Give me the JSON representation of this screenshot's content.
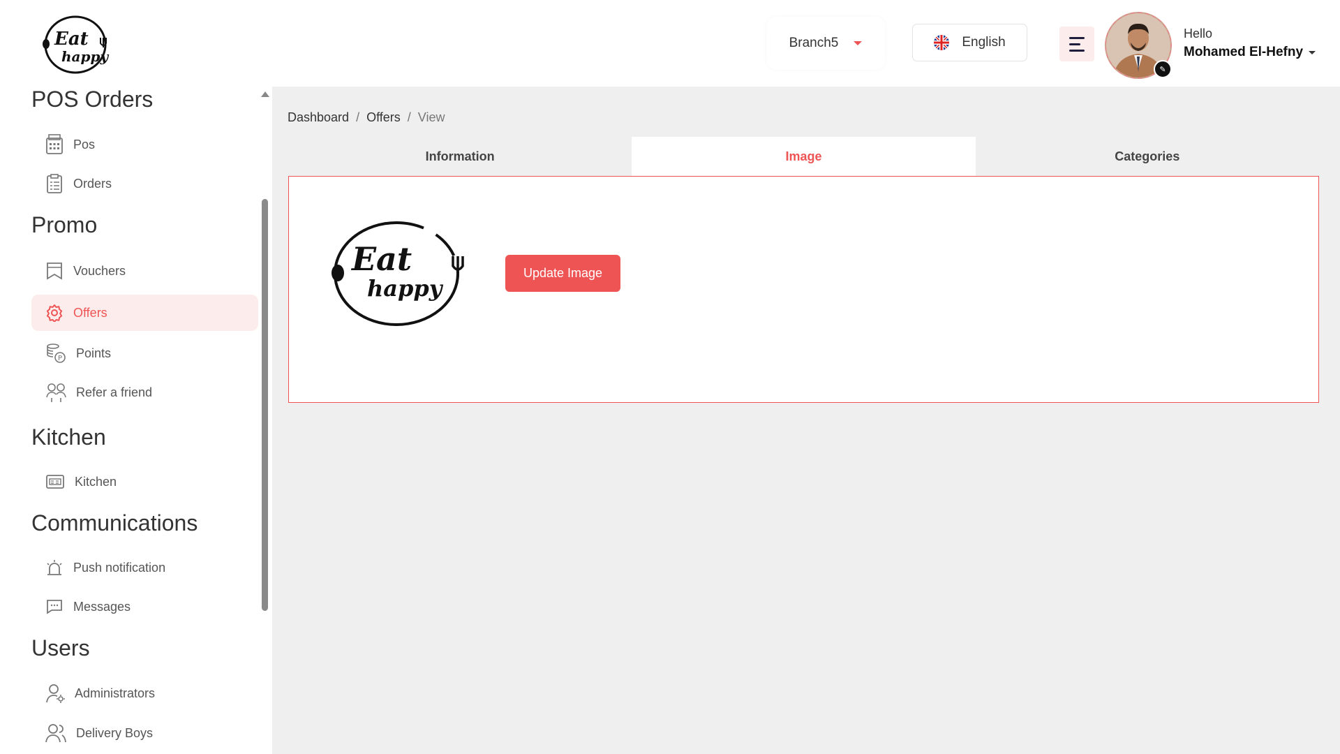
{
  "brand": {
    "logo_line1": "Eat",
    "logo_line2": "happy"
  },
  "header": {
    "branch": "Branch5",
    "language": "English",
    "greeting": "Hello",
    "user_name": "Mohamed El-Hefny"
  },
  "sidebar": {
    "sections": [
      {
        "title": "POS Orders",
        "items": [
          {
            "label": "Pos",
            "icon": "pos-icon"
          },
          {
            "label": "Orders",
            "icon": "orders-icon"
          }
        ]
      },
      {
        "title": "Promo",
        "items": [
          {
            "label": "Vouchers",
            "icon": "voucher-icon"
          },
          {
            "label": "Offers",
            "icon": "gear-icon"
          },
          {
            "label": "Points",
            "icon": "coins-icon"
          },
          {
            "label": "Refer a friend",
            "icon": "users-share-icon"
          }
        ]
      },
      {
        "title": "Kitchen",
        "items": [
          {
            "label": "Kitchen",
            "icon": "kitchen-icon"
          }
        ]
      },
      {
        "title": "Communications",
        "items": [
          {
            "label": "Push notification",
            "icon": "bell-icon"
          },
          {
            "label": "Messages",
            "icon": "message-icon"
          }
        ]
      },
      {
        "title": "Users",
        "items": [
          {
            "label": "Administrators",
            "icon": "admin-icon"
          },
          {
            "label": "Delivery Boys",
            "icon": "delivery-icon"
          }
        ]
      }
    ],
    "active_item": "Offers"
  },
  "breadcrumb": {
    "items": [
      "Dashboard",
      "Offers",
      "View"
    ],
    "separator": "/"
  },
  "tabs": [
    {
      "label": "Information"
    },
    {
      "label": "Image"
    },
    {
      "label": "Categories"
    }
  ],
  "active_tab": "Image",
  "image_panel": {
    "button_label": "Update Image"
  },
  "colors": {
    "accent": "#ef5454",
    "accent_light": "#fdecec",
    "background": "#efefef"
  }
}
